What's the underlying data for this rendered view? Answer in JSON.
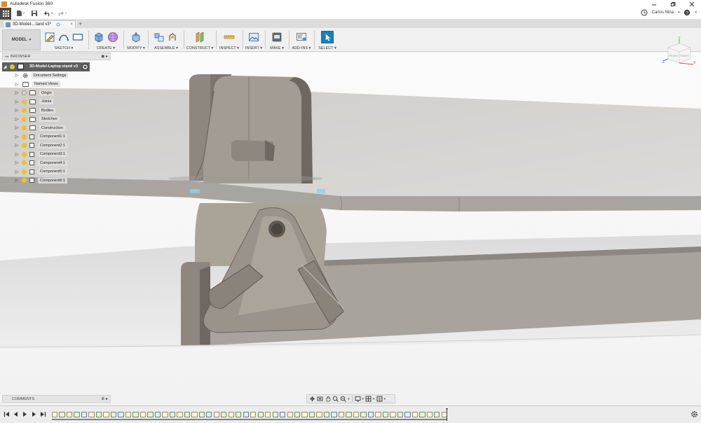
{
  "window": {
    "title": "Autodesk Fusion 360"
  },
  "quick_access": {
    "user_name": "Carlos Nina"
  },
  "tab": {
    "name": "3D-Model-...tand v3*",
    "close": "×"
  },
  "toolbar": {
    "workspace": "MODEL",
    "groups": [
      {
        "label": "SKETCH ▾"
      },
      {
        "label": "CREATE ▾"
      },
      {
        "label": "MODIFY ▾"
      },
      {
        "label": "ASSEMBLE ▾"
      },
      {
        "label": "CONSTRUCT ▾"
      },
      {
        "label": "INSPECT ▾"
      },
      {
        "label": "INSERT ▾"
      },
      {
        "label": "MAKE ▾"
      },
      {
        "label": "ADD-INS ▾"
      },
      {
        "label": "SELECT ▾"
      }
    ]
  },
  "browser": {
    "title": "BROWSER",
    "root": "3D-Model-Laptop-stand v3",
    "items": [
      {
        "label": "Document Settings",
        "icon": "gear-icon"
      },
      {
        "label": "Named Views",
        "icon": "folder-icon"
      },
      {
        "label": "Origin",
        "icon": "folder-icon",
        "bulb": "off"
      },
      {
        "label": "Joints",
        "icon": "folder-icon",
        "bulb": "on"
      },
      {
        "label": "Bodies",
        "icon": "folder-icon",
        "bulb": "on"
      },
      {
        "label": "Sketches",
        "icon": "folder-icon",
        "bulb": "on"
      },
      {
        "label": "Construction",
        "icon": "folder-icon",
        "bulb": "on"
      },
      {
        "label": "Component1:1",
        "icon": "component-icon",
        "bulb": "on"
      },
      {
        "label": "Component2:1",
        "icon": "component-icon",
        "bulb": "on"
      },
      {
        "label": "Component3:1",
        "icon": "component-icon",
        "bulb": "on"
      },
      {
        "label": "Component4:1",
        "icon": "component-icon",
        "bulb": "on"
      },
      {
        "label": "Component5:1",
        "icon": "component-icon",
        "bulb": "on"
      },
      {
        "label": "Component6:1",
        "icon": "component-icon",
        "bulb": "on"
      }
    ]
  },
  "viewcube": {
    "front": "FRONT",
    "right": "RIGHT",
    "axis_x": "X",
    "axis_y": "Y",
    "axis_z": "Z"
  },
  "comments": {
    "title": "COMMENTS"
  },
  "colors": {
    "accent": "#0696d7",
    "model": "#8a847e",
    "surface": "#d4d2cf"
  }
}
